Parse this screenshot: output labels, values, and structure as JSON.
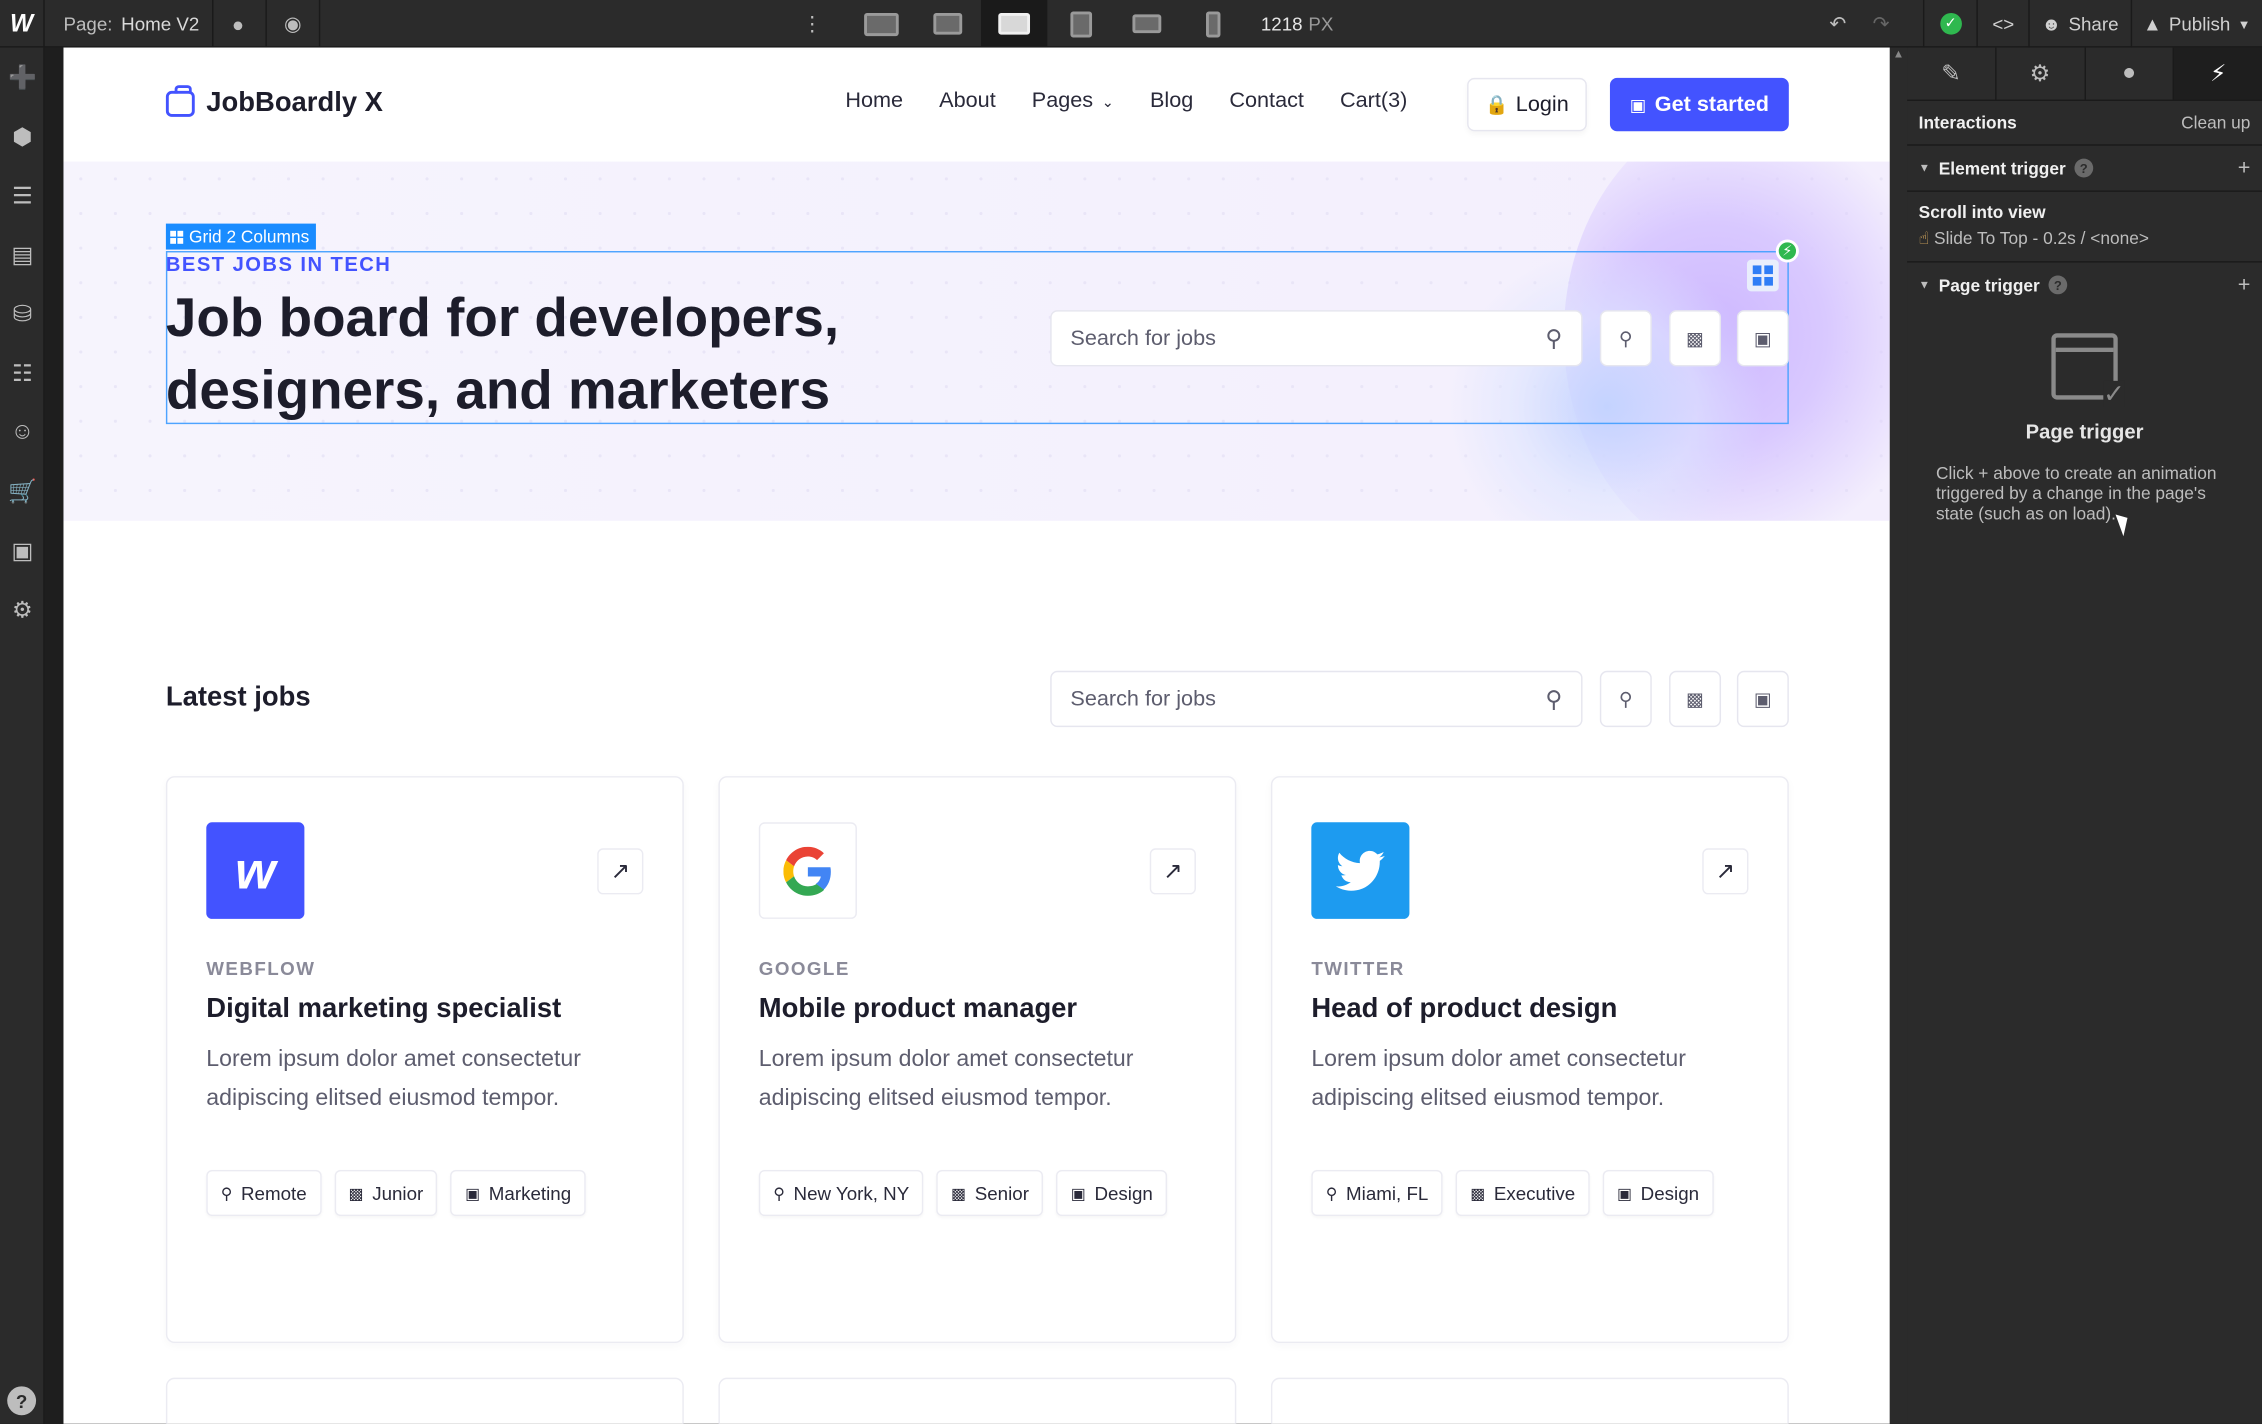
{
  "topbar": {
    "page_label": "Page:",
    "page_name": "Home V2",
    "viewport_width": "1218",
    "viewport_unit": "PX",
    "share_label": "Share",
    "publish_label": "Publish"
  },
  "site": {
    "brand": "JobBoardly X",
    "nav": [
      "Home",
      "About",
      "Pages",
      "Blog",
      "Contact",
      "Cart(3)"
    ],
    "login_label": "Login",
    "cta_label": "Get started"
  },
  "hero": {
    "selection_tag": "Grid 2 Columns",
    "eyebrow": "BEST JOBS IN TECH",
    "title": "Job board for developers, designers, and marketers",
    "search_placeholder": "Search for jobs"
  },
  "latest": {
    "title": "Latest jobs",
    "search_placeholder": "Search for jobs"
  },
  "jobs": [
    {
      "company": "WEBFLOW",
      "role": "Digital marketing specialist",
      "desc": "Lorem ipsum dolor amet consectetur adipiscing elitsed eiusmod tempor.",
      "location": "Remote",
      "level": "Junior",
      "dept": "Marketing",
      "logo_color": "#4353ff",
      "logo_icon": "webflow-logo"
    },
    {
      "company": "GOOGLE",
      "role": "Mobile product manager",
      "desc": "Lorem ipsum dolor amet consectetur adipiscing elitsed eiusmod tempor.",
      "location": "New York, NY",
      "level": "Senior",
      "dept": "Design",
      "logo_color": "#ffffff",
      "logo_icon": "google-logo"
    },
    {
      "company": "TWITTER",
      "role": "Head of product design",
      "desc": "Lorem ipsum dolor amet consectetur adipiscing elitsed eiusmod tempor.",
      "location": "Miami, FL",
      "level": "Executive",
      "dept": "Design",
      "logo_color": "#1d9bf0",
      "logo_icon": "twitter-logo"
    }
  ],
  "panel": {
    "interactions_label": "Interactions",
    "cleanup_label": "Clean up",
    "element_trigger_label": "Element trigger",
    "trigger_name": "Scroll into view",
    "trigger_detail": "Slide To Top - 0.2s / <none>",
    "page_trigger_label": "Page trigger",
    "empty_title": "Page trigger",
    "empty_desc": "Click + above to create an animation triggered by a change in the page's state (such as on load)."
  },
  "colors": {
    "accent": "#4353ff",
    "selection": "#1a8cff",
    "status_ok": "#2fb84f"
  }
}
